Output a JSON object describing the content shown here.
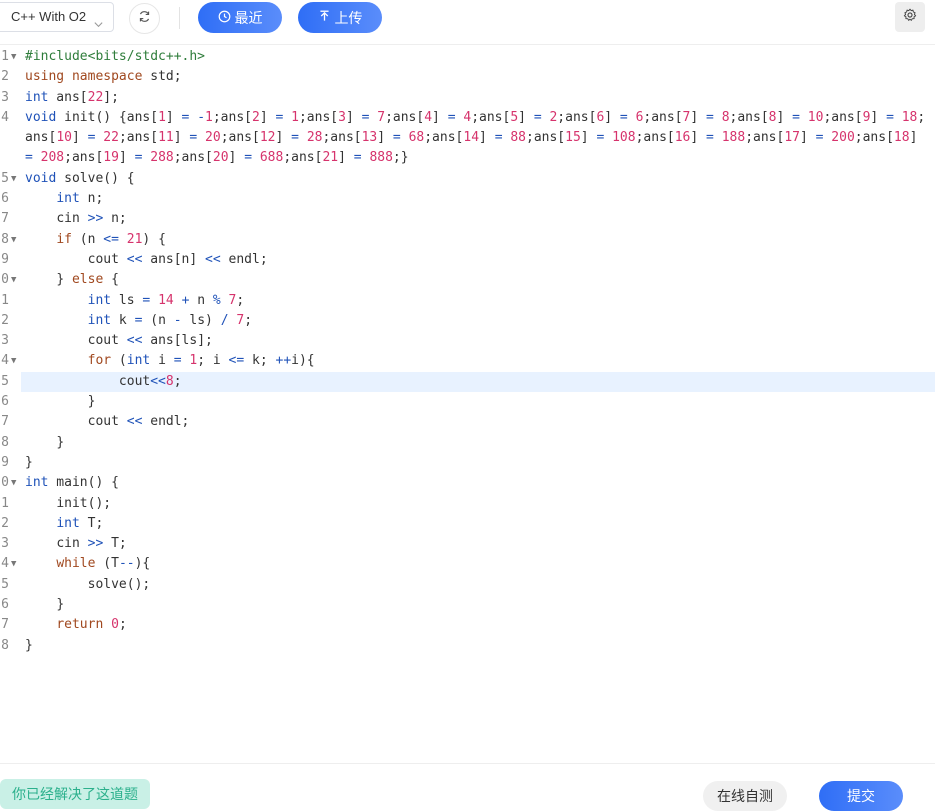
{
  "toolbar": {
    "language_value": "C++ With O2",
    "recent_label": "最近",
    "upload_label": "上传",
    "accent_color": "#3b73f6"
  },
  "editor": {
    "active_line": 15,
    "lines": [
      {
        "num": "1",
        "fold": true
      },
      {
        "num": "2",
        "fold": false
      },
      {
        "num": "3",
        "fold": false
      },
      {
        "num": "4",
        "fold": false
      },
      {
        "num": "5",
        "fold": true
      },
      {
        "num": "6",
        "fold": false
      },
      {
        "num": "7",
        "fold": false
      },
      {
        "num": "8",
        "fold": true
      },
      {
        "num": "9",
        "fold": false
      },
      {
        "num": "0",
        "fold": true
      },
      {
        "num": "1",
        "fold": false
      },
      {
        "num": "2",
        "fold": false
      },
      {
        "num": "3",
        "fold": false
      },
      {
        "num": "4",
        "fold": true
      },
      {
        "num": "5",
        "fold": false
      },
      {
        "num": "6",
        "fold": false
      },
      {
        "num": "7",
        "fold": false
      },
      {
        "num": "8",
        "fold": false
      },
      {
        "num": "9",
        "fold": false
      },
      {
        "num": "0",
        "fold": true
      },
      {
        "num": "1",
        "fold": false
      },
      {
        "num": "2",
        "fold": false
      },
      {
        "num": "3",
        "fold": false
      },
      {
        "num": "4",
        "fold": true
      },
      {
        "num": "5",
        "fold": false
      },
      {
        "num": "6",
        "fold": false
      },
      {
        "num": "7",
        "fold": false
      },
      {
        "num": "8",
        "fold": false
      }
    ],
    "code": [
      "#include<bits/stdc++.h>",
      "using namespace std;",
      "int ans[22];",
      "void init() {ans[1] = -1;ans[2] = 1;ans[3] = 7;ans[4] = 4;ans[5] = 2;ans[6] = 6;ans[7] = 8;ans[8] = 10;ans[9] = 18;ans[10] = 22;ans[11] = 20;ans[12] = 28;ans[13] = 68;ans[14] = 88;ans[15] = 108;ans[16] = 188;ans[17] = 200;ans[18] = 208;ans[19] = 288;ans[20] = 688;ans[21] = 888;}",
      "void solve() {",
      "    int n;",
      "    cin >> n;",
      "    if (n <= 21) {",
      "        cout << ans[n] << endl;",
      "    } else {",
      "        int ls = 14 + n % 7;",
      "        int k = (n - ls) / 7;",
      "        cout << ans[ls];",
      "        for (int i = 1; i <= k; ++i){",
      "            cout<<8;",
      "        }",
      "        cout << endl;",
      "    }",
      "}",
      "int main() {",
      "    init();",
      "    int T;",
      "    cin >> T;",
      "    while (T--){",
      "        solve();",
      "    }",
      "    return 0;",
      "}"
    ]
  },
  "footer": {
    "solved_label": "你已经解决了这道题",
    "self_test_label": "在线自测",
    "submit_label": "提交"
  }
}
